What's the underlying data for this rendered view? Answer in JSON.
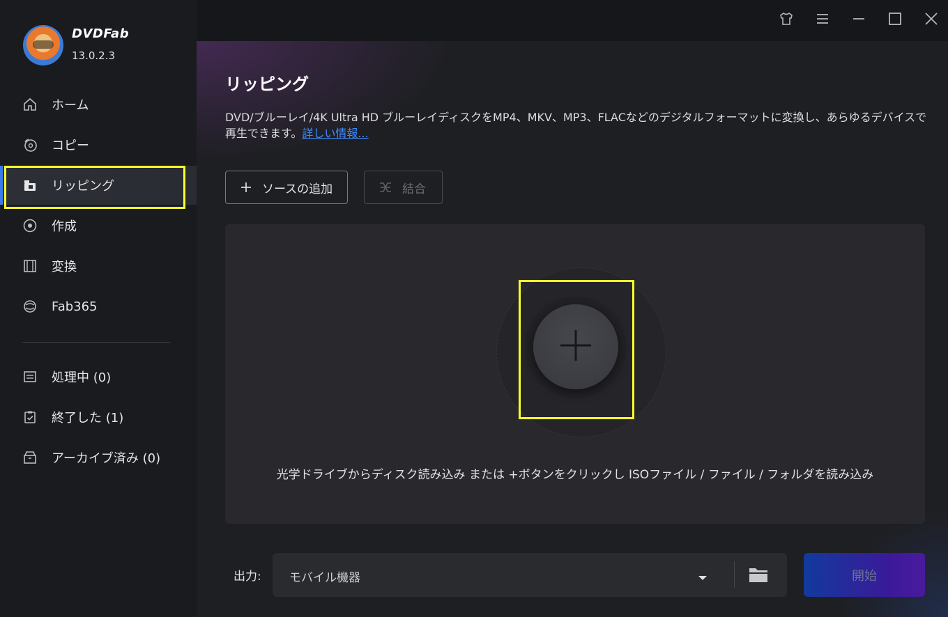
{
  "app": {
    "name": "DVDFab",
    "version": "13.0.2.3"
  },
  "sidebar": {
    "items": [
      {
        "label": "ホーム",
        "icon": "home-icon"
      },
      {
        "label": "コピー",
        "icon": "disc-copy-icon"
      },
      {
        "label": "リッピング",
        "icon": "ripping-icon",
        "active": true
      },
      {
        "label": "作成",
        "icon": "disc-create-icon"
      },
      {
        "label": "変換",
        "icon": "film-icon"
      },
      {
        "label": "Fab365",
        "icon": "fab365-icon"
      }
    ],
    "queue": [
      {
        "label": "処理中 (0)",
        "icon": "list-icon"
      },
      {
        "label": "終了した (1)",
        "icon": "clipboard-check-icon"
      },
      {
        "label": "アーカイブ済み (0)",
        "icon": "archive-icon"
      }
    ]
  },
  "titlebar": {
    "icons": [
      "skin-icon",
      "menu-icon",
      "minimize-icon",
      "maximize-icon",
      "close-icon"
    ]
  },
  "main": {
    "title": "リッピング",
    "description": "DVD/ブルーレイ/4K Ultra HD ブルーレイディスクをMP4、MKV、MP3、FLACなどのデジタルフォーマットに変換し、あらゆるデバイスで再生できます。",
    "more_link": "詳しい情報...",
    "add_source_label": "ソースの追加",
    "merge_label": "結合",
    "drop_hint": "光学ドライブからディスク読み込み または +ボタンをクリックし ISOファイル / ファイル / フォルダを読み込み",
    "output_label": "出力:",
    "output_value": "モバイル機器",
    "start_label": "開始"
  },
  "colors": {
    "accent": "#3a7bf0",
    "highlight": "#ffff2a",
    "link": "#3d8cff"
  }
}
